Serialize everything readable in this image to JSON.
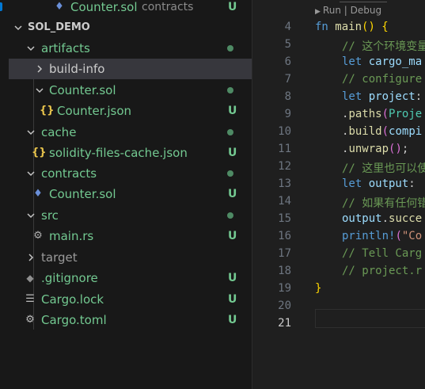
{
  "explorer": {
    "rows": [
      {
        "label": "Counter.sol",
        "desc": "contracts",
        "badge": "U",
        "icon": "ethereum-icon"
      },
      {
        "label": "SOL_DEMO"
      },
      {
        "label": "artifacts"
      },
      {
        "label": "build-info"
      },
      {
        "label": "Counter.sol"
      },
      {
        "label": "Counter.json",
        "badge": "U",
        "icon": "json-braces-icon"
      },
      {
        "label": "cache"
      },
      {
        "label": "solidity-files-cache.json",
        "badge": "U",
        "icon": "json-braces-icon"
      },
      {
        "label": "contracts"
      },
      {
        "label": "Counter.sol",
        "badge": "U",
        "icon": "ethereum-icon"
      },
      {
        "label": "src"
      },
      {
        "label": "main.rs",
        "badge": "U",
        "icon": "rust-icon"
      },
      {
        "label": "target"
      },
      {
        "label": ".gitignore",
        "badge": "U",
        "icon": "git-icon"
      },
      {
        "label": "Cargo.lock",
        "badge": "U",
        "icon": "lines-icon"
      },
      {
        "label": "Cargo.toml",
        "badge": "U",
        "icon": "gear-icon"
      }
    ]
  },
  "editor": {
    "codelens": "Run | Debug",
    "active_line": "21",
    "lines": [
      {
        "n": "4",
        "t": "fn main() {"
      },
      {
        "n": "5",
        "t": "// 这个环境变量"
      },
      {
        "n": "6",
        "t": "let cargo_ma"
      },
      {
        "n": "7",
        "t": "// configure"
      },
      {
        "n": "8",
        "t": "let project:"
      },
      {
        "n": "9",
        "t": ".paths(Proje"
      },
      {
        "n": "10",
        "t": ".build(compi"
      },
      {
        "n": "11",
        "t": ".unwrap();"
      },
      {
        "n": "12",
        "t": "// 这里也可以使"
      },
      {
        "n": "13",
        "t": "let output: "
      },
      {
        "n": "14",
        "t": "// 如果有任何错"
      },
      {
        "n": "15",
        "t": "output.succe"
      },
      {
        "n": "16",
        "t": "println!(\"Co"
      },
      {
        "n": "17",
        "t": "// Tell Carg"
      },
      {
        "n": "18",
        "t": "// project.r"
      },
      {
        "n": "19",
        "t": "}"
      },
      {
        "n": "20",
        "t": ""
      },
      {
        "n": "21",
        "t": ""
      }
    ]
  },
  "colors": {
    "untracked": "#73c991",
    "selection": "#37373d",
    "accent": "#0078d4"
  }
}
